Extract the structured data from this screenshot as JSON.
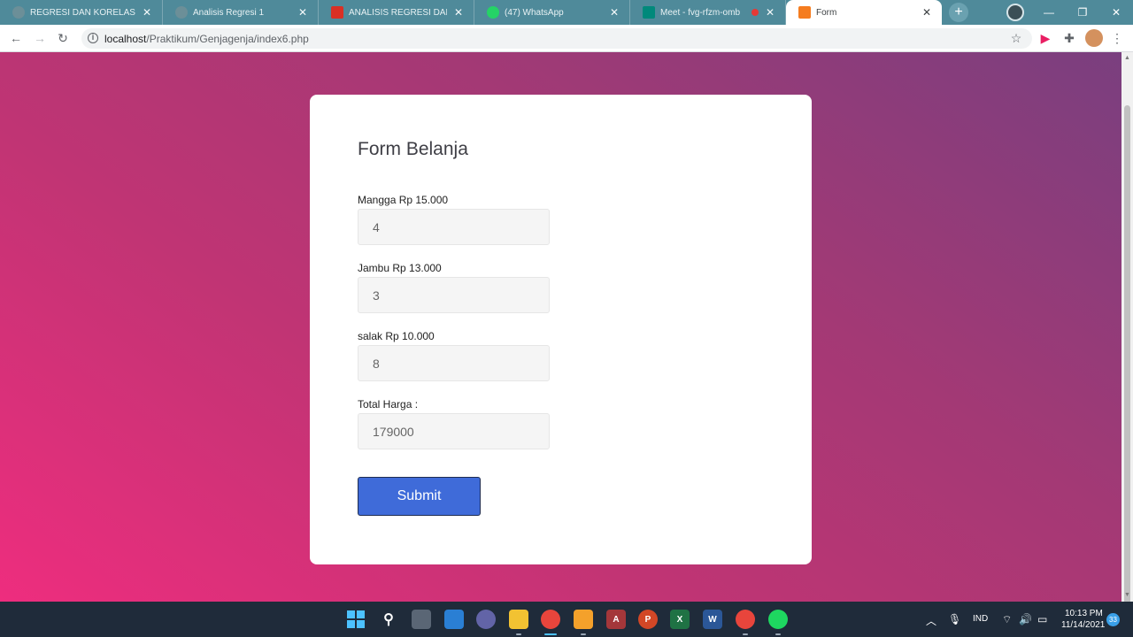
{
  "browser": {
    "tabs": [
      {
        "title": "REGRESI DAN KORELASI",
        "icon": "globe-icon",
        "color": "#6c8f98"
      },
      {
        "title": "Analisis Regresi 1",
        "icon": "globe-icon",
        "color": "#6c8f98"
      },
      {
        "title": "ANALISIS REGRESI DAN KORELASI",
        "icon": "document-icon",
        "color": "#d93025"
      },
      {
        "title": "(47) WhatsApp",
        "icon": "whatsapp-icon",
        "color": "#25d366"
      },
      {
        "title": "Meet - fvg-rfzm-omb",
        "icon": "meet-icon",
        "color": "#00897b"
      },
      {
        "title": "Form",
        "icon": "xampp-icon",
        "color": "#f57c1f",
        "active": true
      }
    ],
    "new_tab_label": "+",
    "url_host": "localhost",
    "url_path": "/Praktikum/Genjagenja/index6.php"
  },
  "form": {
    "title": "Form Belanja",
    "fields": [
      {
        "label": "Mangga Rp 15.000",
        "value": "4"
      },
      {
        "label": "Jambu Rp 13.000",
        "value": "3"
      },
      {
        "label": "salak Rp 10.000",
        "value": "8"
      },
      {
        "label": "Total Harga :",
        "value": "179000"
      }
    ],
    "submit_label": "Submit"
  },
  "taskbar": {
    "apps": [
      "windows-start-icon",
      "search-icon",
      "task-view-icon",
      "widgets-icon",
      "chat-icon",
      "file-explorer-icon",
      "chrome-icon",
      "sublime-icon",
      "access-icon",
      "powerpoint-icon",
      "excel-icon",
      "word-icon",
      "chrome-profile-icon",
      "spotify-icon"
    ],
    "language": "IND",
    "time": "10:13 PM",
    "date": "11/14/2021",
    "notifications": "33"
  },
  "colors": {
    "accent": "#3f6bd9",
    "tabstrip": "#4f8a9a",
    "gradient_top": "#7a3f7f",
    "gradient_bottom": "#ee2d7e"
  }
}
